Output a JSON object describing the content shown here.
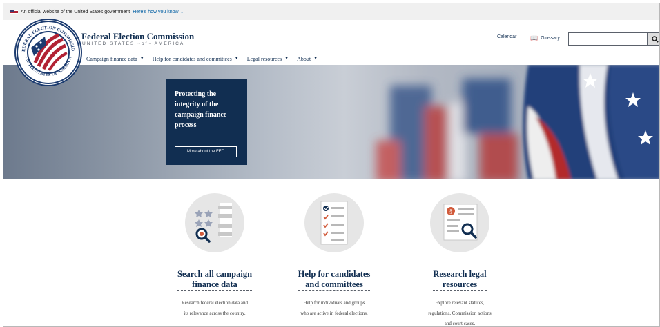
{
  "gov_banner": {
    "text": "An official website of the United States government",
    "link": "Here's how you know"
  },
  "seal": {
    "top_text": "FEDERAL ELECTION COMMISSION",
    "bottom_text": "UNITED STATES OF AMERICA"
  },
  "brand": {
    "title": "Federal Election Commission",
    "subtitle": "UNITED STATES ~of~ AMERICA"
  },
  "utility": {
    "calendar": "Calendar",
    "glossary": "Glossary"
  },
  "search": {
    "value": "",
    "placeholder": ""
  },
  "nav": {
    "items": [
      {
        "label": "Campaign finance data"
      },
      {
        "label": "Help for candidates and committees"
      },
      {
        "label": "Legal resources"
      },
      {
        "label": "About"
      }
    ]
  },
  "hero": {
    "text": "Protecting the integrity of the campaign finance process",
    "button": "More about the FEC"
  },
  "cards": [
    {
      "title_line1": "Search all campaign",
      "title_line2": "finance data",
      "desc_line1": "Research federal election data and",
      "desc_line2": "its relevance across the country."
    },
    {
      "title_line1": "Help for candidates",
      "title_line2": "and committees",
      "desc_line1": "Help for individuals and groups",
      "desc_line2": "who are active in federal elections."
    },
    {
      "title_line1": "Research legal",
      "title_line2": "resources",
      "desc_line1": "Explore relevant statutes,",
      "desc_line2": "regulations, Commission actions",
      "desc_line3": "and court cases."
    }
  ],
  "colors": {
    "navy": "#112e51",
    "red": "#b22234",
    "gray": "#e6e6e6",
    "link": "#005ea2"
  },
  "icons": [
    "us-flag-icon",
    "chevron-down-icon",
    "book-icon",
    "search-icon",
    "caret-down-icon",
    "magnifier-icon",
    "checklist-icon",
    "legal-document-icon"
  ]
}
